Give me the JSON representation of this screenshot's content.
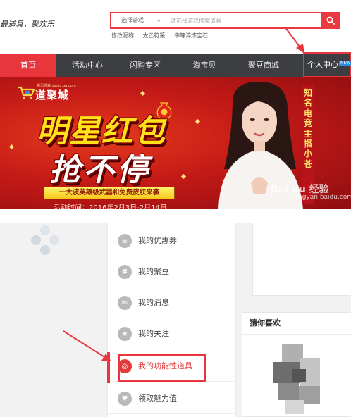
{
  "header": {
    "slogan": "最道具，聚欢乐",
    "search": {
      "select_label": "选择游戏",
      "placeholder": "请选择游戏搜索道具"
    },
    "hot_links": [
      "修改昵称",
      "太乙符篆",
      "中等淬炼宝石"
    ]
  },
  "nav": {
    "items": [
      {
        "label": "首页",
        "active": true
      },
      {
        "label": "活动中心",
        "active": false
      },
      {
        "label": "闪购专区",
        "active": false
      },
      {
        "label": "淘宝贝",
        "active": false
      },
      {
        "label": "聚豆商城",
        "active": false
      }
    ],
    "user_center": {
      "label": "个人中心",
      "badge": "NEW"
    }
  },
  "banner": {
    "brand_url": "腾讯游戏 daoju.qq.com",
    "brand": "道聚城",
    "title_line1": "明星红包",
    "title_line2": "抢不停",
    "strip": "一大波英雄级武器和免费皮肤来袭",
    "date": "活动时间：2016年2月3日-2月14日",
    "vertical_text": "知名电竞主播小苍",
    "watermark": "Bai du 经验",
    "watermark_sub": "jingyan.baidu.com"
  },
  "menu": {
    "items": [
      {
        "label": "我的优惠券",
        "icon": "coupon-icon",
        "glyph": "≡",
        "active": false
      },
      {
        "label": "我的聚豆",
        "icon": "bean-icon",
        "glyph": "¥",
        "active": false
      },
      {
        "label": "我的消息",
        "icon": "message-icon",
        "glyph": "✉",
        "active": false
      },
      {
        "label": "我的关注",
        "icon": "star-icon",
        "glyph": "★",
        "active": false
      },
      {
        "label": "我的功能性道具",
        "icon": "target-icon",
        "glyph": "◎",
        "active": true
      },
      {
        "label": "领取魅力值",
        "icon": "heart-icon",
        "glyph": "♥",
        "active": false
      }
    ]
  },
  "guess": {
    "title": "猜你喜欢"
  },
  "colors": {
    "accent": "#e8363c",
    "nav_bg": "#3d3e42",
    "banner_red": "#c41a17",
    "banner_yellow": "#ffe21a"
  }
}
